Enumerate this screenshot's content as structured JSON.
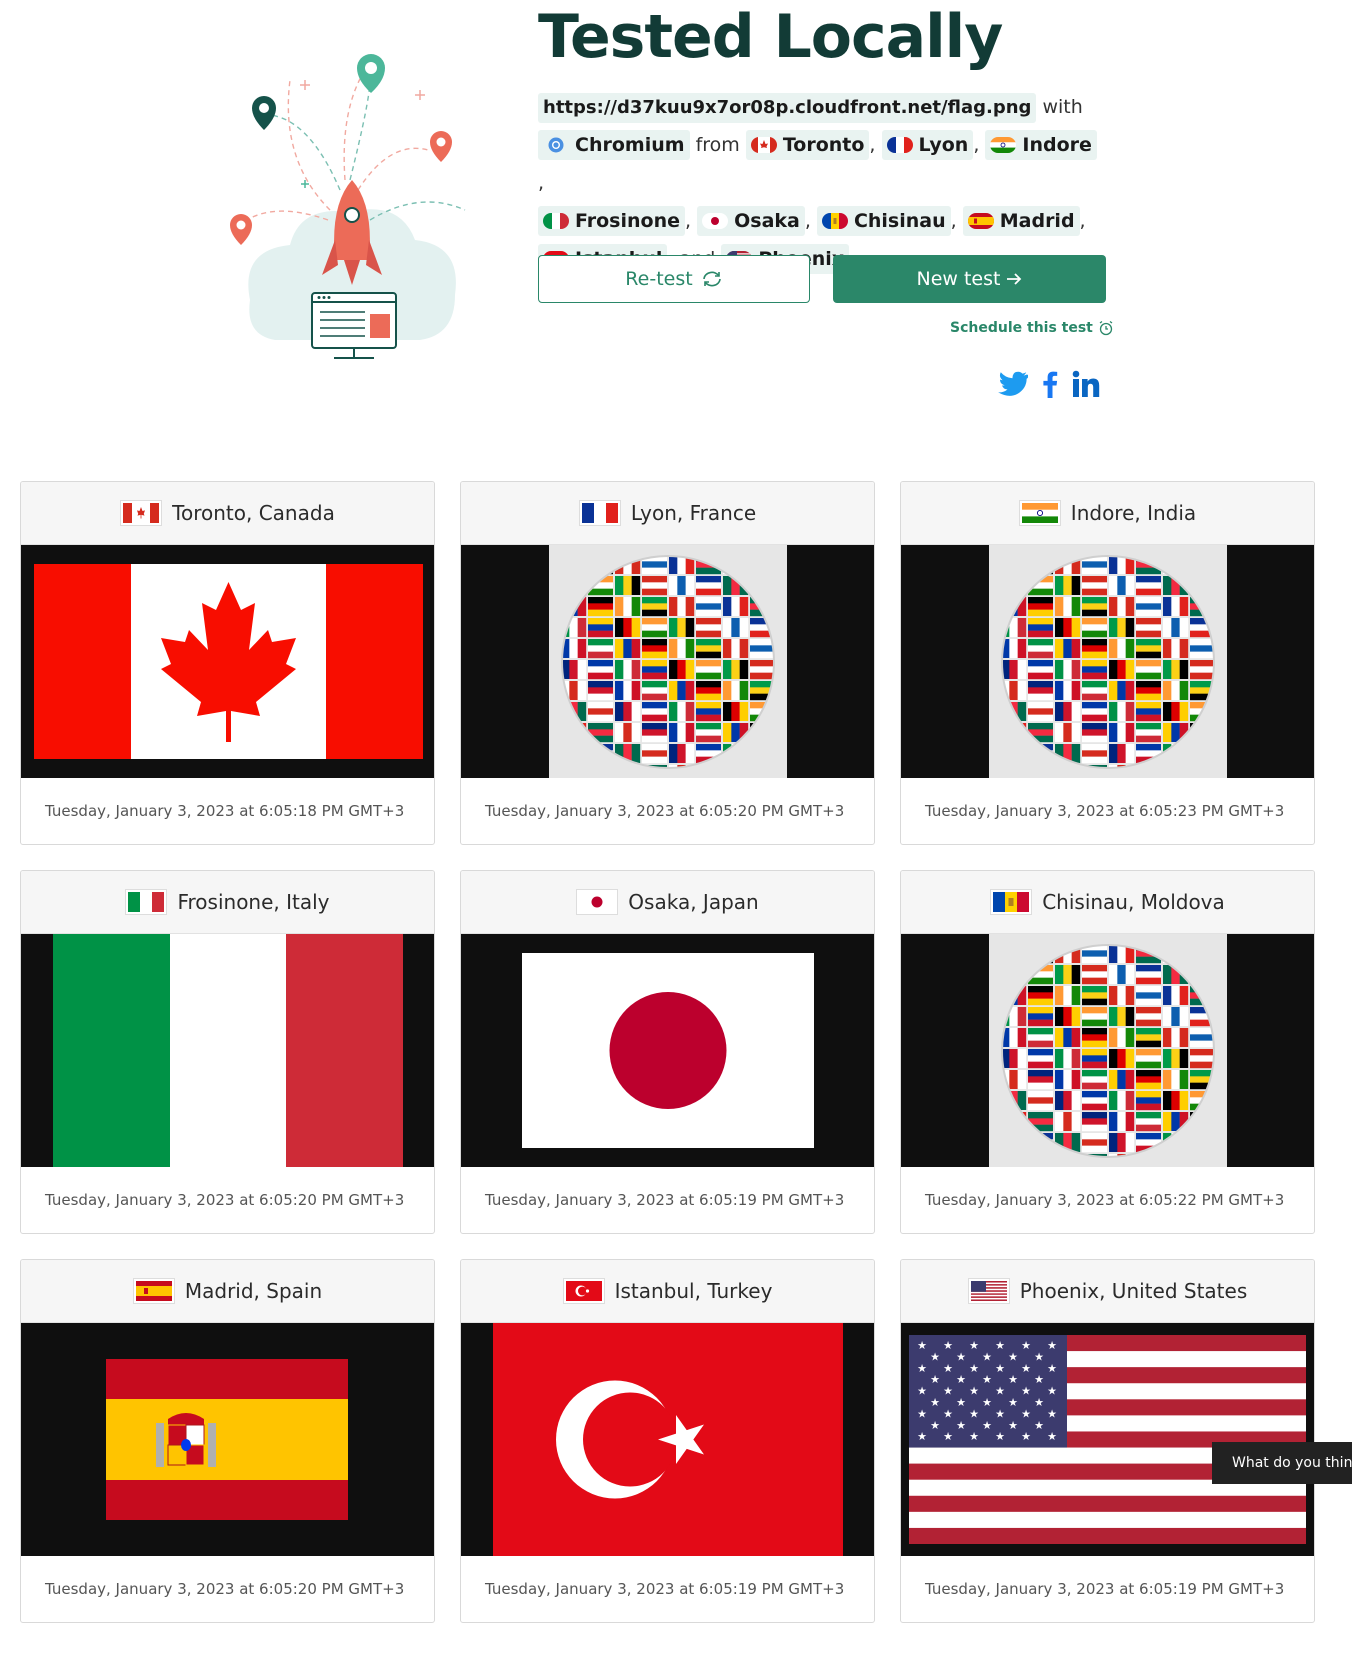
{
  "title": "Tested Locally",
  "summary": {
    "url": "https://d37kuu9x7or08p.cloudfront.net/flag.png",
    "with_text": "with",
    "browser": "Chromium",
    "from_text": "from",
    "and_text": "and",
    "locations": [
      "Toronto",
      "Lyon",
      "Indore",
      "Frosinone",
      "Osaka",
      "Chisinau",
      "Madrid",
      "Istanbul",
      "Phoenix"
    ]
  },
  "actions": {
    "retest_label": "Re-test",
    "new_test_label": "New test",
    "schedule_label": "Schedule this test"
  },
  "social": [
    "twitter-icon",
    "facebook-icon",
    "linkedin-icon"
  ],
  "colors": {
    "brand": "#2b8769",
    "title": "#123b36"
  },
  "results": [
    {
      "location": "Toronto, Canada",
      "flag": "canada",
      "screenshot": "canada-flag",
      "timestamp": "Tuesday, January 3, 2023 at 6:05:18 PM GMT+3"
    },
    {
      "location": "Lyon, France",
      "flag": "france",
      "screenshot": "world-globe",
      "timestamp": "Tuesday, January 3, 2023 at 6:05:20 PM GMT+3"
    },
    {
      "location": "Indore, India",
      "flag": "india",
      "screenshot": "world-globe",
      "timestamp": "Tuesday, January 3, 2023 at 6:05:23 PM GMT+3"
    },
    {
      "location": "Frosinone, Italy",
      "flag": "italy",
      "screenshot": "italy-flag",
      "timestamp": "Tuesday, January 3, 2023 at 6:05:20 PM GMT+3"
    },
    {
      "location": "Osaka, Japan",
      "flag": "japan",
      "screenshot": "japan-flag",
      "timestamp": "Tuesday, January 3, 2023 at 6:05:19 PM GMT+3"
    },
    {
      "location": "Chisinau, Moldova",
      "flag": "moldova",
      "screenshot": "world-globe",
      "timestamp": "Tuesday, January 3, 2023 at 6:05:22 PM GMT+3"
    },
    {
      "location": "Madrid, Spain",
      "flag": "spain",
      "screenshot": "spain-flag",
      "timestamp": "Tuesday, January 3, 2023 at 6:05:20 PM GMT+3"
    },
    {
      "location": "Istanbul, Turkey",
      "flag": "turkey",
      "screenshot": "turkey-flag",
      "timestamp": "Tuesday, January 3, 2023 at 6:05:19 PM GMT+3"
    },
    {
      "location": "Phoenix, United States",
      "flag": "usa",
      "screenshot": "usa-flag",
      "timestamp": "Tuesday, January 3, 2023 at 6:05:19 PM GMT+3"
    }
  ],
  "feedback": {
    "label": "What do you think"
  }
}
